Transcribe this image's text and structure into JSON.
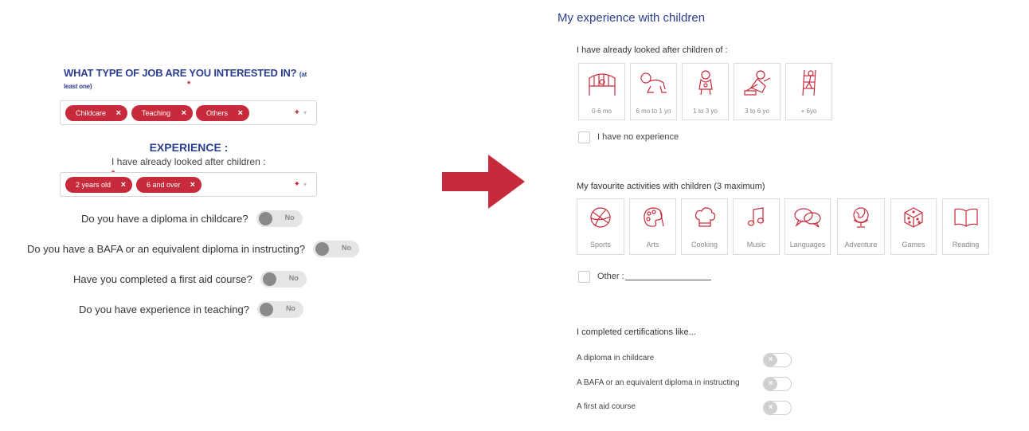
{
  "left": {
    "job_question": "WHAT TYPE OF JOB ARE YOU INTERESTED IN?",
    "job_question_note": "(at least one)",
    "required_mark": "*",
    "job_chips": [
      {
        "label": "Childcare",
        "remove": "×"
      },
      {
        "label": "Teaching",
        "remove": "×"
      },
      {
        "label": "Others",
        "remove": "×"
      }
    ],
    "experience_title": "EXPERIENCE :",
    "experience_sub": "I have already looked after children :",
    "experience_chips": [
      {
        "label": "2 years old",
        "remove": "×"
      },
      {
        "label": "6 and over",
        "remove": "×"
      }
    ],
    "select_clear": "✦",
    "select_caret": "▾",
    "questions": [
      {
        "text": "Do you have a diploma in childcare?",
        "value": "No"
      },
      {
        "text": "Do you have a BAFA or an equivalent diploma in instructing?",
        "value": "No"
      },
      {
        "text": "Have you completed a first aid course?",
        "value": "No"
      },
      {
        "text": "Do you have experience in teaching?",
        "value": "No"
      }
    ]
  },
  "arrow_color": "#c62a3b",
  "right": {
    "title": "My experience with children",
    "ages_label": "I have already looked after children of :",
    "ages": [
      {
        "label": "0-6 mo",
        "icon": "crib-icon"
      },
      {
        "label": "6 mo to 1 yo",
        "icon": "crawling-baby-icon"
      },
      {
        "label": "1 to 3 yo",
        "icon": "toddler-icon"
      },
      {
        "label": "3 to 6 yo",
        "icon": "child-playing-icon"
      },
      {
        "label": "+ 6yo",
        "icon": "child-climbing-icon"
      }
    ],
    "no_experience": "I have no experience",
    "activities_label": "My favourite activities with children (3 maximum)",
    "activities": [
      {
        "label": "Sports",
        "icon": "ball-icon"
      },
      {
        "label": "Arts",
        "icon": "palette-icon"
      },
      {
        "label": "Cooking",
        "icon": "chef-hat-icon"
      },
      {
        "label": "Music",
        "icon": "music-note-icon"
      },
      {
        "label": "Languages",
        "icon": "speech-bubbles-icon"
      },
      {
        "label": "Adventure",
        "icon": "globe-icon"
      },
      {
        "label": "Games",
        "icon": "dice-icon"
      },
      {
        "label": "Reading",
        "icon": "book-icon"
      }
    ],
    "other_label": "Other :",
    "certs_label": "I completed certifications like...",
    "certs": [
      {
        "label": "A diploma in childcare"
      },
      {
        "label": "A BAFA or an equivalent diploma in instructing"
      },
      {
        "label": "A first aid course"
      }
    ],
    "toggle_off_glyph": "×"
  },
  "colors": {
    "brand_blue": "#2b3f8f",
    "brand_red": "#c62a3b"
  }
}
